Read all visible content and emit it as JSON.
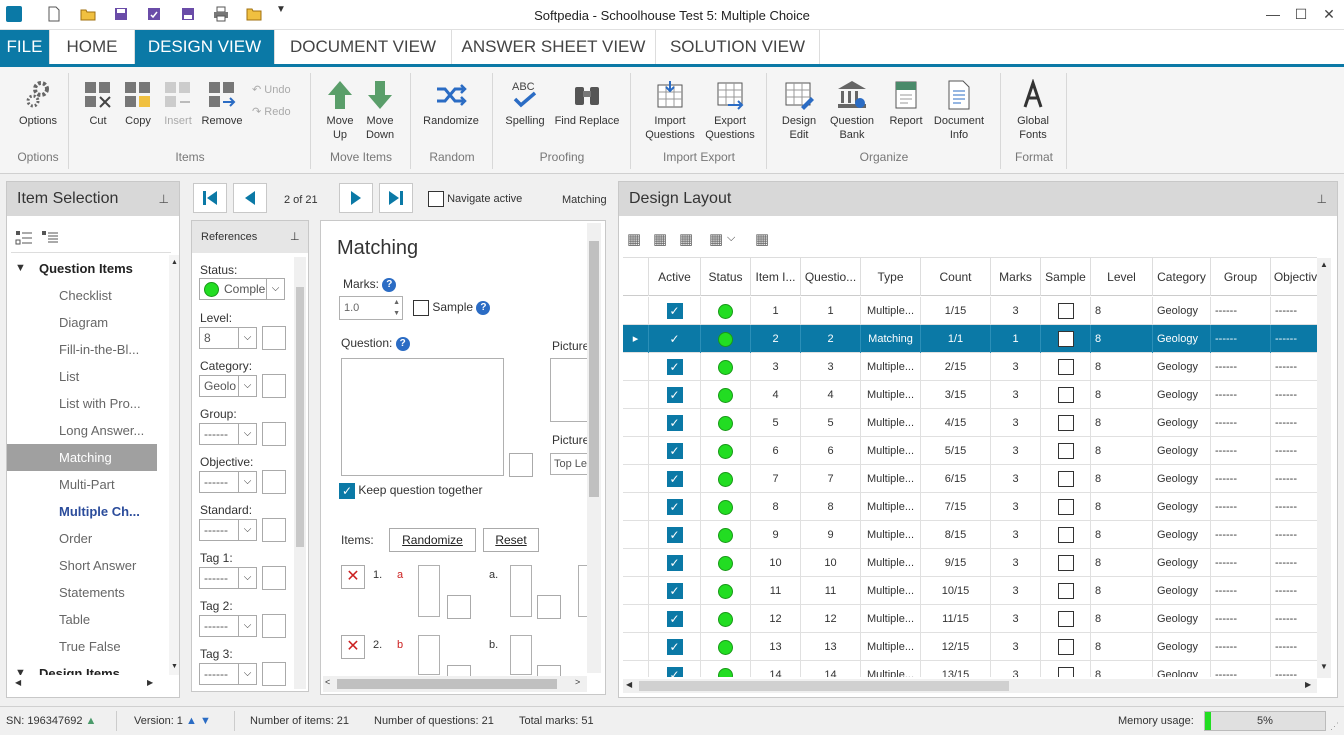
{
  "window": {
    "title": "Softpedia - Schoolhouse Test 5: Multiple Choice"
  },
  "tabs": [
    {
      "label": "FILE"
    },
    {
      "label": "HOME"
    },
    {
      "label": "DESIGN VIEW"
    },
    {
      "label": "DOCUMENT VIEW"
    },
    {
      "label": "ANSWER SHEET VIEW"
    },
    {
      "label": "SOLUTION VIEW"
    }
  ],
  "ribbon": {
    "options": "Options",
    "cut": "Cut",
    "copy": "Copy",
    "insert": "Insert",
    "remove": "Remove",
    "undo": "Undo",
    "redo": "Redo",
    "move_up": [
      "Move",
      "Up"
    ],
    "move_down": [
      "Move",
      "Down"
    ],
    "randomize": "Randomize",
    "spelling": "Spelling",
    "find_replace": "Find Replace",
    "import_questions": [
      "Import",
      "Questions"
    ],
    "export_questions": [
      "Export",
      "Questions"
    ],
    "design_edit": [
      "Design",
      "Edit"
    ],
    "question_bank": [
      "Question",
      "Bank"
    ],
    "report": "Report",
    "document_info": [
      "Document",
      "Info"
    ],
    "global_fonts": [
      "Global",
      "Fonts"
    ],
    "groups": {
      "options": "Options",
      "items": "Items",
      "move_items": "Move Items",
      "random": "Random",
      "proofing": "Proofing",
      "import_export": "Import Export",
      "organize": "Organize",
      "format": "Format"
    }
  },
  "item_selection": {
    "title": "Item Selection",
    "question_items_label": "Question Items",
    "question_items": [
      "Checklist",
      "Diagram",
      "Fill-in-the-Bl...",
      "List",
      "List with Pro...",
      "Long Answer...",
      "Matching",
      "Multi-Part",
      "Multiple Ch...",
      "Order",
      "Short Answer",
      "Statements",
      "Table",
      "True False"
    ],
    "selected": "Matching",
    "current": "Multiple Ch...",
    "design_items_label": "Design Items"
  },
  "navigation": {
    "position": "2 of 21",
    "navigate_active": "Navigate active",
    "item_type": "Matching"
  },
  "references": {
    "title": "References",
    "status_label": "Status:",
    "status_value": "Comple",
    "level_label": "Level:",
    "level_value": "8",
    "category_label": "Category:",
    "category_value": "Geolo",
    "group_label": "Group:",
    "group_value": "------",
    "objective_label": "Objective:",
    "objective_value": "------",
    "standard_label": "Standard:",
    "standard_value": "------",
    "tag1_label": "Tag 1:",
    "tag1_value": "------",
    "tag2_label": "Tag 2:",
    "tag2_value": "------",
    "tag3_label": "Tag 3:",
    "tag3_value": "------"
  },
  "editor": {
    "heading": "Matching",
    "marks_label": "Marks:",
    "marks_value": "1.0",
    "sample_label": "Sample",
    "question_label": "Question:",
    "picture_label": "Picture",
    "picture2_label": "Picture",
    "picture_pos": "Top Le",
    "keep_together": "Keep question together",
    "items_label": "Items:",
    "randomize_btn": "Randomize",
    "reset_btn": "Reset",
    "pairs": [
      {
        "num": "1.",
        "left": "a",
        "right": "a."
      },
      {
        "num": "2.",
        "left": "b",
        "right": "b."
      }
    ],
    "footer": "Matching"
  },
  "design_layout": {
    "title": "Design Layout",
    "columns": [
      "Active",
      "Status",
      "Item I...",
      "Questio...",
      "Type",
      "Count",
      "Marks",
      "Sample",
      "Level",
      "Category",
      "Group",
      "Objectiv"
    ],
    "rows": [
      {
        "item": "1",
        "question": "1",
        "type": "Multiple...",
        "count": "1/15",
        "marks": "3",
        "level": "8",
        "category": "Geology",
        "group": "------",
        "objective": "------"
      },
      {
        "item": "2",
        "question": "2",
        "type": "Matching",
        "count": "1/1",
        "marks": "1",
        "level": "8",
        "category": "Geology",
        "group": "------",
        "objective": "------"
      },
      {
        "item": "3",
        "question": "3",
        "type": "Multiple...",
        "count": "2/15",
        "marks": "3",
        "level": "8",
        "category": "Geology",
        "group": "------",
        "objective": "------"
      },
      {
        "item": "4",
        "question": "4",
        "type": "Multiple...",
        "count": "3/15",
        "marks": "3",
        "level": "8",
        "category": "Geology",
        "group": "------",
        "objective": "------"
      },
      {
        "item": "5",
        "question": "5",
        "type": "Multiple...",
        "count": "4/15",
        "marks": "3",
        "level": "8",
        "category": "Geology",
        "group": "------",
        "objective": "------"
      },
      {
        "item": "6",
        "question": "6",
        "type": "Multiple...",
        "count": "5/15",
        "marks": "3",
        "level": "8",
        "category": "Geology",
        "group": "------",
        "objective": "------"
      },
      {
        "item": "7",
        "question": "7",
        "type": "Multiple...",
        "count": "6/15",
        "marks": "3",
        "level": "8",
        "category": "Geology",
        "group": "------",
        "objective": "------"
      },
      {
        "item": "8",
        "question": "8",
        "type": "Multiple...",
        "count": "7/15",
        "marks": "3",
        "level": "8",
        "category": "Geology",
        "group": "------",
        "objective": "------"
      },
      {
        "item": "9",
        "question": "9",
        "type": "Multiple...",
        "count": "8/15",
        "marks": "3",
        "level": "8",
        "category": "Geology",
        "group": "------",
        "objective": "------"
      },
      {
        "item": "10",
        "question": "10",
        "type": "Multiple...",
        "count": "9/15",
        "marks": "3",
        "level": "8",
        "category": "Geology",
        "group": "------",
        "objective": "------"
      },
      {
        "item": "11",
        "question": "11",
        "type": "Multiple...",
        "count": "10/15",
        "marks": "3",
        "level": "8",
        "category": "Geology",
        "group": "------",
        "objective": "------"
      },
      {
        "item": "12",
        "question": "12",
        "type": "Multiple...",
        "count": "11/15",
        "marks": "3",
        "level": "8",
        "category": "Geology",
        "group": "------",
        "objective": "------"
      },
      {
        "item": "13",
        "question": "13",
        "type": "Multiple...",
        "count": "12/15",
        "marks": "3",
        "level": "8",
        "category": "Geology",
        "group": "------",
        "objective": "------"
      },
      {
        "item": "14",
        "question": "14",
        "type": "Multiple...",
        "count": "13/15",
        "marks": "3",
        "level": "8",
        "category": "Geology",
        "group": "------",
        "objective": "------"
      }
    ],
    "selected_row": 1
  },
  "statusbar": {
    "sn_label": "SN:",
    "sn_value": "196347692",
    "version": "Version: 1",
    "num_items": "Number of items: 21",
    "num_questions": "Number of questions: 21",
    "total_marks": "Total marks: 51",
    "memory_label": "Memory usage:",
    "memory_value": "5%",
    "memory_fraction": 0.05
  },
  "colors": {
    "accent": "#0b79a6",
    "status_green": "#22dd22",
    "delete_red": "#cc2222"
  }
}
